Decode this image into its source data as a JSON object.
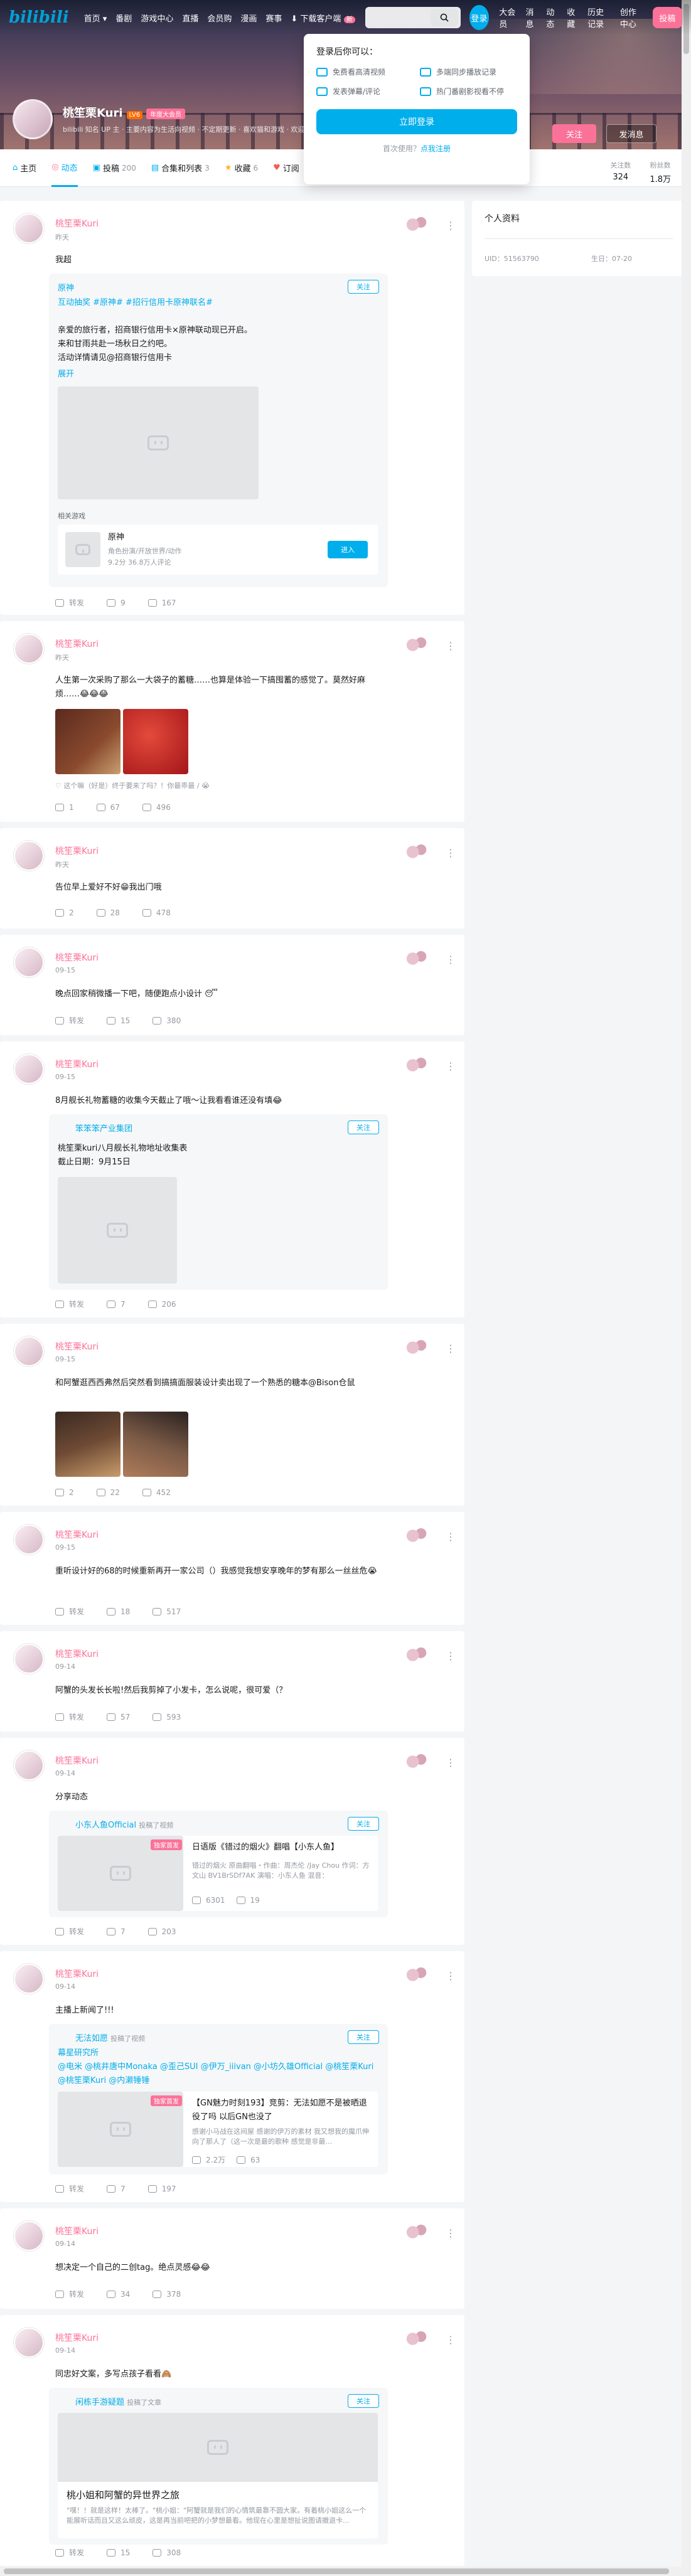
{
  "header": {
    "logo": "bilibili",
    "nav": [
      "首页 ▾",
      "番剧",
      "游戏中心",
      "直播",
      "会员购",
      "漫画",
      "赛事",
      "下载客户端"
    ],
    "download_badge": "新",
    "login_label": "登录",
    "right_nav": [
      "大会员",
      "消息",
      "动态",
      "收藏",
      "历史记录",
      "创作中心"
    ],
    "upload_label": "投稿"
  },
  "login_popup": {
    "title": "登录后你可以：",
    "items": [
      "免费看高清视频",
      "多端同步播放记录",
      "发表弹幕/评论",
      "热门番剧影视看不停"
    ],
    "button": "立即登录",
    "register_prefix": "首次使用？",
    "register_link": "点我注册"
  },
  "profile": {
    "name": "桃笙栗Kuri",
    "level": "LV6",
    "vip": "年度大会员",
    "sign": "bilibili 知名 UP 主 · 主要内容为生活向视频 · 不定期更新 · 喜欢猫和游戏 · 欢迎关注！",
    "follow_label": "关注",
    "message_label": "发消息",
    "stats": [
      {
        "label": "关注数",
        "value": "324"
      },
      {
        "label": "粉丝数",
        "value": "1.8万"
      }
    ]
  },
  "tabs": [
    {
      "label": "主页",
      "count": ""
    },
    {
      "label": "动态",
      "count": ""
    },
    {
      "label": "投稿",
      "count": "200"
    },
    {
      "label": "合集和列表",
      "count": "3"
    },
    {
      "label": "收藏",
      "count": "6"
    },
    {
      "label": "订阅",
      "count": ""
    }
  ],
  "side": {
    "title": "个人资料",
    "uid": "UID：51563790",
    "birthday": "生日：07-20"
  },
  "posts": [
    {
      "name": "桃笙栗Kuri",
      "time": "昨天",
      "text": "我超",
      "embed_author": "原神",
      "embed_text_1": "互动抽奖 #原神# #招行信用卡原神联名#",
      "embed_text_2": "亲爱的旅行者，招商银行信用卡×原神联动现已开启。",
      "embed_text_3": "来和甘雨共赴一场秋日之约吧。",
      "embed_text_4": "活动详情请见@招商银行信用卡",
      "embed_more": "展开",
      "related_label": "相关游戏",
      "game_name": "原神",
      "game_desc": "角色扮演/开放世界/动作",
      "game_meta": "9.2分 36.8万人评论",
      "game_btn": "进入",
      "follow": "关注",
      "share": "转发",
      "comments": "9",
      "likes": "167"
    },
    {
      "name": "桃笙栗Kuri",
      "time": "昨天",
      "text": "人生第一次采购了那么一大袋子的蓄糖……也算是体验一下搞囤蓄的感觉了。莫然好麻烦……😂😂😂",
      "lottery": "♡ 这个嘛（好是）终于要来了吗？！你最乖最 / 😭",
      "share": "1",
      "comments": "67",
      "likes": "496"
    },
    {
      "name": "桃笙栗Kuri",
      "time": "昨天",
      "text": "告位早上爱好不好😁我出门哦",
      "share": "2",
      "comments": "28",
      "likes": "478"
    },
    {
      "name": "桃笙栗Kuri",
      "time": "09-15",
      "text": "晚点回家稍微播一下吧，随便跑点小设计 😴",
      "share": "转发",
      "comments": "15",
      "likes": "380"
    },
    {
      "name": "桃笙栗Kuri",
      "time": "09-15",
      "text": "8月舰长礼物蓄糖的收集今天截止了哦～让我看看谁还没有填😂",
      "embed_author": "笨笨笨产业集团",
      "embed_text_1": "桃笙栗kuri八月舰长礼物地址收集表",
      "embed_text_2": "截止日期：9月15日",
      "follow": "关注",
      "share": "转发",
      "comments": "7",
      "likes": "206"
    },
    {
      "name": "桃笙栗Kuri",
      "time": "09-15",
      "text": "和阿蟹逛西西弗然后突然看到搞搞面服装设计卖出现了一个熟悉的糖本@Bison仓鼠",
      "share": "2",
      "comments": "22",
      "likes": "452"
    },
    {
      "name": "桃笙栗Kuri",
      "time": "09-15",
      "text": "重听设计好的68的时候重新再开一家公司（）我感觉我想安享晚年的梦有那么一丝丝危😭",
      "share": "转发",
      "comments": "18",
      "likes": "517"
    },
    {
      "name": "桃笙栗Kuri",
      "time": "09-14",
      "text": "阿蟹的头发长长啦!然后我剪掉了小发卡，怎么说呢，很可爱（？",
      "share": "转发",
      "comments": "57",
      "likes": "593"
    },
    {
      "name": "桃笙栗Kuri",
      "time": "09-14",
      "text": "分享动态",
      "embed_author": "小东人鱼Official",
      "embed_sub": "投稿了视频",
      "video_badge": "独家首发",
      "video_title": "日语版《错过的烟火》翻唱【小东人鱼】",
      "video_desc": "错过的烟火 原曲翻唱・作曲：周杰伦 /Jay Chou 作词：方文山 BV1BrSDf7AK 演唱：小东人鱼 混音：",
      "video_views": "6301",
      "video_comments": "19",
      "follow": "关注",
      "share": "转发",
      "comments": "7",
      "likes": "203"
    },
    {
      "name": "桃笙栗Kuri",
      "time": "09-14",
      "text": "主播上新闻了!!!",
      "embed_author": "无法如愿",
      "embed_sub": "投稿了视频",
      "embed_text_1": "幕星研究所",
      "embed_text_2": "@电米 @桃井唐中Monaka @歪己SUI @伊万_iiivan @小坊久雄Official @桃笙栗Kuri @桃笙栗Kuri @内濑锤锤",
      "video_badge": "独家首发",
      "video_title": "【GN魅力时刻193】竞剪：无法如愿不是被晒退役了吗 以后GN也没了",
      "video_desc": "感谢小马战在这间屋 感谢的伊万的素材 我又想我的魔爪伸向了那人了（这一次是最的歌种 感觉是非最...",
      "video_views": "2.2万",
      "video_comments": "63",
      "follow": "关注",
      "share": "转发",
      "comments": "7",
      "likes": "197"
    },
    {
      "name": "桃笙栗Kuri",
      "time": "09-14",
      "text": "想决定一个自己的二创tag。绝点灵感😂😂",
      "share": "转发",
      "comments": "34",
      "likes": "378"
    },
    {
      "name": "桃笙栗Kuri",
      "time": "09-14",
      "text": "同忠好文案，多写点孩子看看🙈",
      "embed_author": "闲栋手游疑题",
      "embed_sub": "投稿了文章",
      "article_title": "桃小姐和阿蟹的异世界之旅",
      "article_desc": "\"嘿！！就是这样！太棒了。\"桃小姐：\"阿蟹就是我们的心情筑最靠不圆大家。有着桃小姐这么一个能展听话而且又这么顽皮，这是再当前吧把的小梦想最看。他现在心里是想扯说图请撤退卡...",
      "follow": "关注",
      "share": "转发",
      "comments": "15",
      "likes": "308"
    }
  ],
  "colors": {
    "accent": "#00aeec",
    "pink": "#fb7299"
  }
}
